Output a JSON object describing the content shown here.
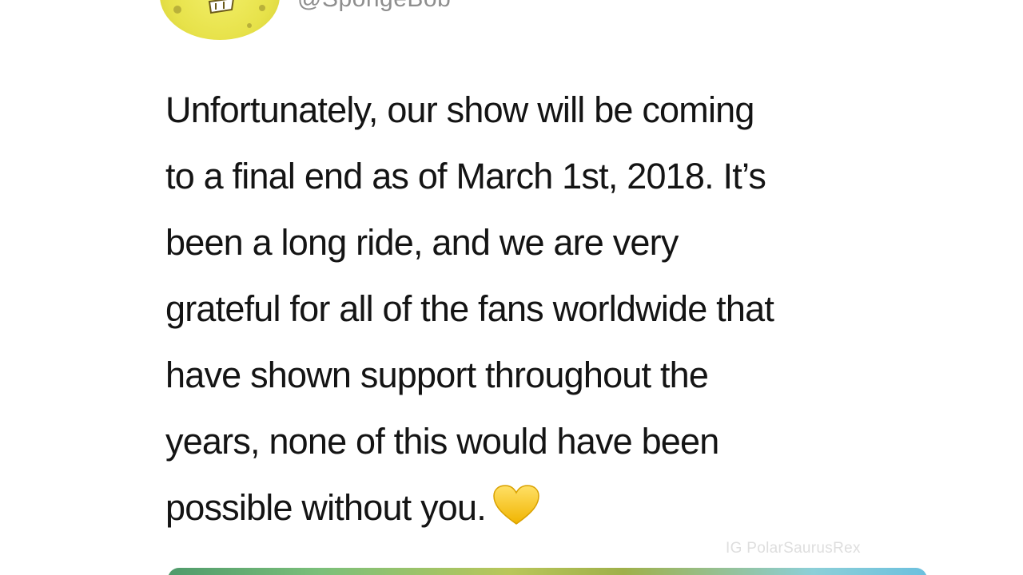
{
  "tweet": {
    "handle": "@SpongeBob",
    "avatar_icon": "spongebob-avatar",
    "text_lines": [
      "Unfortunately, our show will be coming",
      "to a final end as of March 1st, 2018. It’s",
      "been a long ride, and we are very",
      "grateful for all of the fans worldwide that",
      "have shown support throughout the",
      "years, none of this would have been",
      "possible without you."
    ],
    "emoji": "yellow-heart-icon",
    "watermark": "IG PolarSaurusRex"
  },
  "colors": {
    "text": "#141414",
    "handle": "#8e8e8e",
    "avatar_yellow": "#e7e24a",
    "heart_yellow": "#f5c518"
  }
}
